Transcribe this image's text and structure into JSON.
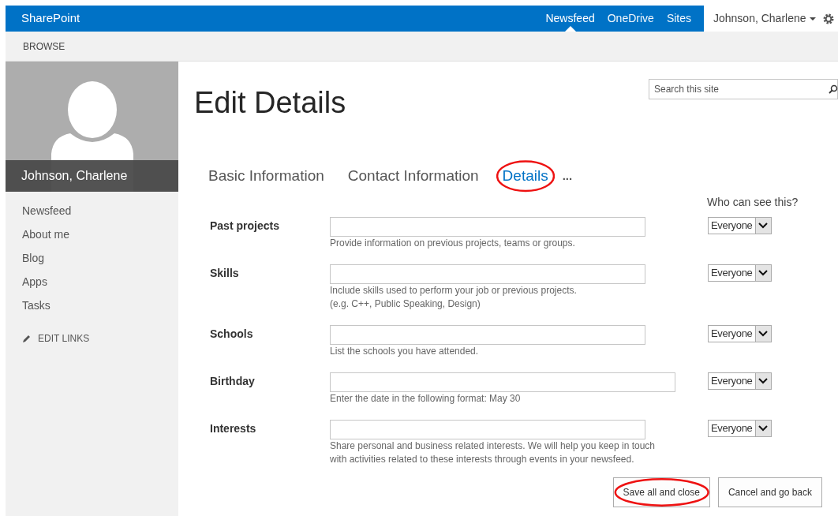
{
  "top_bar": {
    "brand": "SharePoint",
    "links": [
      {
        "label": "Newsfeed",
        "selected": true
      },
      {
        "label": "OneDrive",
        "selected": false
      },
      {
        "label": "Sites",
        "selected": false
      }
    ],
    "user": "Johnson, Charlene"
  },
  "ribbon": {
    "tab": "BROWSE"
  },
  "sidebar": {
    "name": "Johnson, Charlene",
    "items": [
      "Newsfeed",
      "About me",
      "Blog",
      "Apps",
      "Tasks"
    ],
    "edit_links": "EDIT LINKS"
  },
  "search": {
    "placeholder": "Search this site"
  },
  "title": "Edit Details",
  "tabs": [
    {
      "label": "Basic Information",
      "selected": false,
      "circled": false
    },
    {
      "label": "Contact Information",
      "selected": false,
      "circled": false
    },
    {
      "label": "Details",
      "selected": true,
      "circled": true
    }
  ],
  "more": "...",
  "visibility_header": "Who can see this?",
  "fields": [
    {
      "label": "Past projects",
      "kind": "short",
      "hint": [
        "Provide information on previous projects, teams or groups."
      ],
      "visibility": "Everyone"
    },
    {
      "label": "Skills",
      "kind": "short",
      "hint": [
        "Include skills used to perform your job or previous projects.",
        "(e.g. C++, Public Speaking, Design)"
      ],
      "visibility": "Everyone"
    },
    {
      "label": "Schools",
      "kind": "short",
      "hint": [
        "List the schools you have attended."
      ],
      "visibility": "Everyone"
    },
    {
      "label": "Birthday",
      "kind": "long",
      "hint": [
        "Enter the date in the following format: May 30"
      ],
      "visibility": "Everyone"
    },
    {
      "label": "Interests",
      "kind": "short",
      "hint": [
        "Share personal and business related interests. We will help you keep in touch",
        "with activities related to these interests through events in your newsfeed."
      ],
      "visibility": "Everyone"
    }
  ],
  "buttons": [
    {
      "label": "Save all and close",
      "circled": true
    },
    {
      "label": "Cancel and go back",
      "circled": false
    }
  ]
}
